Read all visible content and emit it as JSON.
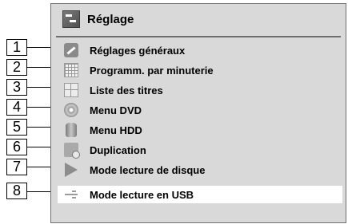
{
  "header": {
    "title": "Réglage",
    "icon": "settings-menu-icon"
  },
  "callouts": [
    "1",
    "2",
    "3",
    "4",
    "5",
    "6",
    "7",
    "8"
  ],
  "menu": {
    "selected_index": 7,
    "items": [
      {
        "label": "Réglages généraux",
        "icon": "wrench-icon"
      },
      {
        "label": "Programm. par minuterie",
        "icon": "timer-grid-icon"
      },
      {
        "label": "Liste des titres",
        "icon": "title-list-icon"
      },
      {
        "label": "Menu DVD",
        "icon": "dvd-disc-icon"
      },
      {
        "label": "Menu HDD",
        "icon": "hdd-icon"
      },
      {
        "label": "Duplication",
        "icon": "duplication-icon"
      },
      {
        "label": "Mode lecture de disque",
        "icon": "disc-playback-icon"
      },
      {
        "label": "Mode lecture en USB",
        "icon": "usb-icon"
      }
    ]
  },
  "colors": {
    "panel_bg": "#d9d9d9",
    "selected_bg": "#ffffff",
    "border": "#6e6e6e"
  }
}
